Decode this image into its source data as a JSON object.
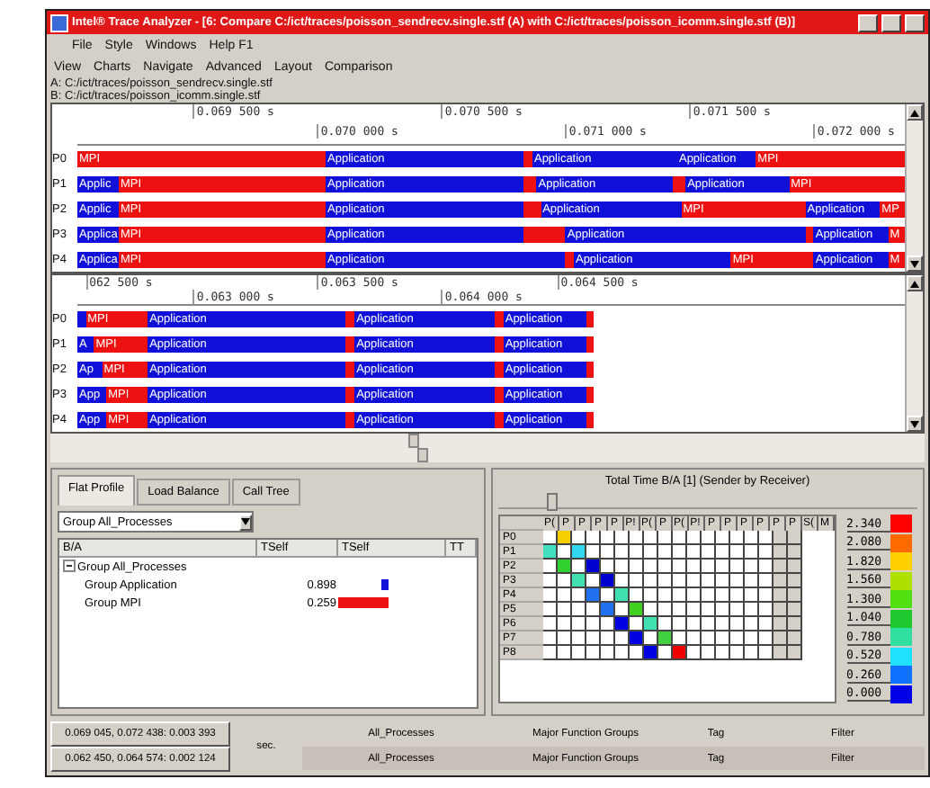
{
  "window": {
    "title": "Intel® Trace Analyzer - [6: Compare C:/ict/traces/poisson_sendrecv.single.stf (A) with C:/ict/traces/poisson_icomm.single.stf (B)]"
  },
  "menu_bar": [
    "File",
    "Style",
    "Windows",
    "Help F1"
  ],
  "view_menu": [
    "View",
    "Charts",
    "Navigate",
    "Advanced",
    "Layout",
    "Comparison"
  ],
  "files": [
    "A: C:/ict/traces/poisson_sendrecv.single.stf",
    "B: C:/ict/traces/poisson_icomm.single.stf"
  ],
  "timeline_a": {
    "ruler_upper": [
      "0.069 500 s",
      "0.070 500 s",
      "0.071 500 s"
    ],
    "ruler_lower": [
      "0.070 000 s",
      "0.071 000 s",
      "0.072 000 s"
    ],
    "rows": [
      {
        "label": "P0",
        "segments": [
          {
            "kind": "mpi",
            "label": "MPI"
          },
          {
            "kind": "app",
            "label": "Application"
          },
          {
            "kind": "mpi"
          },
          {
            "kind": "app",
            "label": "Application"
          },
          {
            "kind": "app",
            "label": "Application"
          },
          {
            "kind": "mpi",
            "label": "MPI"
          }
        ]
      },
      {
        "label": "P1",
        "segments": [
          {
            "kind": "app",
            "label": "Applic"
          },
          {
            "kind": "mpi",
            "label": "MPI"
          },
          {
            "kind": "app",
            "label": "Application"
          },
          {
            "kind": "mpi"
          },
          {
            "kind": "app",
            "label": "Application"
          },
          {
            "kind": "mpi"
          },
          {
            "kind": "app",
            "label": "Application"
          },
          {
            "kind": "mpi",
            "label": "MPI"
          }
        ]
      },
      {
        "label": "P2",
        "segments": [
          {
            "kind": "app",
            "label": "Applic"
          },
          {
            "kind": "mpi",
            "label": "MPI"
          },
          {
            "kind": "app",
            "label": "Application"
          },
          {
            "kind": "mpi"
          },
          {
            "kind": "app",
            "label": "Application"
          },
          {
            "kind": "mpi",
            "label": "MPI"
          },
          {
            "kind": "app",
            "label": "Application"
          },
          {
            "kind": "mpi",
            "label": "MP"
          }
        ]
      },
      {
        "label": "P3",
        "segments": [
          {
            "kind": "app",
            "label": "Applica"
          },
          {
            "kind": "mpi",
            "label": "MPI"
          },
          {
            "kind": "app",
            "label": "Application"
          },
          {
            "kind": "mpi"
          },
          {
            "kind": "mpi"
          },
          {
            "kind": "app",
            "label": "Application"
          },
          {
            "kind": "mpi"
          },
          {
            "kind": "app",
            "label": "Application"
          },
          {
            "kind": "mpi",
            "label": "M"
          }
        ]
      },
      {
        "label": "P4",
        "segments": [
          {
            "kind": "app",
            "label": "Applica"
          },
          {
            "kind": "mpi",
            "label": "MPI"
          },
          {
            "kind": "app",
            "label": "Application"
          },
          {
            "kind": "mpi"
          },
          {
            "kind": "app",
            "label": "Application"
          },
          {
            "kind": "mpi",
            "label": "MPI"
          },
          {
            "kind": "app",
            "label": "Application"
          },
          {
            "kind": "mpi",
            "label": "M"
          }
        ]
      }
    ]
  },
  "timeline_b": {
    "ruler_upper": [
      "062 500 s",
      "0.063 500 s",
      "0.064 500 s"
    ],
    "ruler_lower": [
      "0.063 000 s",
      "0.064 000 s"
    ],
    "rows": [
      {
        "label": "P0",
        "segments": [
          {
            "kind": "app"
          },
          {
            "kind": "mpi",
            "label": "MPI"
          },
          {
            "kind": "app",
            "label": "Application"
          },
          {
            "kind": "mpi"
          },
          {
            "kind": "app",
            "label": "Application"
          },
          {
            "kind": "mpi"
          },
          {
            "kind": "app",
            "label": "Application"
          },
          {
            "kind": "mpi"
          }
        ]
      },
      {
        "label": "P1",
        "segments": [
          {
            "kind": "app",
            "label": "A"
          },
          {
            "kind": "mpi",
            "label": "MPI"
          },
          {
            "kind": "app",
            "label": "Application"
          },
          {
            "kind": "mpi"
          },
          {
            "kind": "app",
            "label": "Application"
          },
          {
            "kind": "mpi"
          },
          {
            "kind": "app",
            "label": "Application"
          },
          {
            "kind": "mpi"
          }
        ]
      },
      {
        "label": "P2",
        "segments": [
          {
            "kind": "app",
            "label": "Ap"
          },
          {
            "kind": "mpi",
            "label": "MPI"
          },
          {
            "kind": "app",
            "label": "Application"
          },
          {
            "kind": "mpi"
          },
          {
            "kind": "app",
            "label": "Application"
          },
          {
            "kind": "mpi"
          },
          {
            "kind": "app",
            "label": "Application"
          },
          {
            "kind": "mpi"
          }
        ]
      },
      {
        "label": "P3",
        "segments": [
          {
            "kind": "app",
            "label": "App"
          },
          {
            "kind": "mpi",
            "label": "MPI"
          },
          {
            "kind": "app",
            "label": "Application"
          },
          {
            "kind": "mpi"
          },
          {
            "kind": "app",
            "label": "Application"
          },
          {
            "kind": "mpi"
          },
          {
            "kind": "app",
            "label": "Application"
          },
          {
            "kind": "mpi"
          }
        ]
      },
      {
        "label": "P4",
        "segments": [
          {
            "kind": "app",
            "label": "App"
          },
          {
            "kind": "mpi",
            "label": "MPI"
          },
          {
            "kind": "app",
            "label": "Application"
          },
          {
            "kind": "mpi"
          },
          {
            "kind": "app",
            "label": "Application"
          },
          {
            "kind": "mpi"
          },
          {
            "kind": "app",
            "label": "Application"
          },
          {
            "kind": "mpi"
          }
        ]
      }
    ]
  },
  "profile": {
    "tabs": [
      {
        "label": "Flat Profile",
        "selected": true
      },
      {
        "label": "Load Balance",
        "selected": false
      },
      {
        "label": "Call Tree",
        "selected": false
      }
    ],
    "group_select": "Group All_Processes",
    "columns": [
      "B/A",
      "TSelf",
      "TSelf",
      "TT"
    ],
    "tree": [
      {
        "label": "Group All_Processes",
        "expanded": true,
        "children": [
          {
            "label": "Group Application",
            "value": "0.898",
            "kind": "app"
          },
          {
            "label": "Group MPI",
            "value": "0.259",
            "kind": "mpi"
          }
        ]
      }
    ]
  },
  "matrix": {
    "title": "Total Time B/A [1] (Sender by Receiver)",
    "slider": {
      "level": 0.13
    },
    "columns": [
      "P(",
      "P",
      "P",
      "P",
      "P",
      "P!",
      "P(",
      "P",
      "P(",
      "P!",
      "P",
      "P",
      "P",
      "P",
      "P",
      "P",
      "S(",
      "M"
    ],
    "rows": [
      {
        "label": "P0",
        "cells": [
          {
            "color": "#ffffff"
          },
          {
            "color": "#f5d000"
          },
          {
            "color": "#ffffff"
          },
          {
            "color": "#ffffff"
          },
          {
            "color": "#ffffff"
          },
          {
            "color": "#ffffff"
          },
          {
            "color": "#ffffff"
          },
          {
            "color": "#ffffff"
          },
          {
            "color": "#ffffff"
          },
          {
            "color": "#ffffff"
          },
          {
            "color": "#ffffff"
          },
          {
            "color": "#ffffff"
          },
          {
            "color": "#ffffff"
          },
          {
            "color": "#ffffff"
          },
          {
            "color": "#ffffff"
          },
          {
            "color": "#ffffff"
          }
        ]
      },
      {
        "label": "P1",
        "cells": [
          {
            "color": "#40e0c0"
          },
          {
            "color": "#ffffff"
          },
          {
            "color": "#30d8f0"
          },
          {
            "color": "#ffffff"
          },
          {
            "color": "#ffffff"
          },
          {
            "color": "#ffffff"
          },
          {
            "color": "#ffffff"
          },
          {
            "color": "#ffffff"
          },
          {
            "color": "#ffffff"
          },
          {
            "color": "#ffffff"
          },
          {
            "color": "#ffffff"
          },
          {
            "color": "#ffffff"
          },
          {
            "color": "#ffffff"
          },
          {
            "color": "#ffffff"
          },
          {
            "color": "#ffffff"
          },
          {
            "color": "#ffffff"
          }
        ]
      },
      {
        "label": "P2",
        "cells": [
          {
            "color": "#ffffff"
          },
          {
            "color": "#30d030"
          },
          {
            "color": "#ffffff"
          },
          {
            "color": "#0000d0"
          },
          {
            "color": "#ffffff"
          },
          {
            "color": "#ffffff"
          },
          {
            "color": "#ffffff"
          },
          {
            "color": "#ffffff"
          },
          {
            "color": "#ffffff"
          },
          {
            "color": "#ffffff"
          },
          {
            "color": "#ffffff"
          },
          {
            "color": "#ffffff"
          },
          {
            "color": "#ffffff"
          },
          {
            "color": "#ffffff"
          },
          {
            "color": "#ffffff"
          },
          {
            "color": "#ffffff"
          }
        ]
      },
      {
        "label": "P3",
        "cells": [
          {
            "color": "#ffffff"
          },
          {
            "color": "#ffffff"
          },
          {
            "color": "#40e0b0"
          },
          {
            "color": "#ffffff"
          },
          {
            "color": "#0000d0"
          },
          {
            "color": "#ffffff"
          },
          {
            "color": "#ffffff"
          },
          {
            "color": "#ffffff"
          },
          {
            "color": "#ffffff"
          },
          {
            "color": "#ffffff"
          },
          {
            "color": "#ffffff"
          },
          {
            "color": "#ffffff"
          },
          {
            "color": "#ffffff"
          },
          {
            "color": "#ffffff"
          },
          {
            "color": "#ffffff"
          },
          {
            "color": "#ffffff"
          }
        ]
      },
      {
        "label": "P4",
        "cells": [
          {
            "color": "#ffffff"
          },
          {
            "color": "#ffffff"
          },
          {
            "color": "#ffffff"
          },
          {
            "color": "#2070f0"
          },
          {
            "color": "#ffffff"
          },
          {
            "color": "#40e0b0"
          },
          {
            "color": "#ffffff"
          },
          {
            "color": "#ffffff"
          },
          {
            "color": "#ffffff"
          },
          {
            "color": "#ffffff"
          },
          {
            "color": "#ffffff"
          },
          {
            "color": "#ffffff"
          },
          {
            "color": "#ffffff"
          },
          {
            "color": "#ffffff"
          },
          {
            "color": "#ffffff"
          },
          {
            "color": "#ffffff"
          }
        ]
      },
      {
        "label": "P5",
        "cells": [
          {
            "color": "#ffffff"
          },
          {
            "color": "#ffffff"
          },
          {
            "color": "#ffffff"
          },
          {
            "color": "#ffffff"
          },
          {
            "color": "#2070f0"
          },
          {
            "color": "#ffffff"
          },
          {
            "color": "#40d020"
          },
          {
            "color": "#ffffff"
          },
          {
            "color": "#ffffff"
          },
          {
            "color": "#ffffff"
          },
          {
            "color": "#ffffff"
          },
          {
            "color": "#ffffff"
          },
          {
            "color": "#ffffff"
          },
          {
            "color": "#ffffff"
          },
          {
            "color": "#ffffff"
          },
          {
            "color": "#ffffff"
          }
        ]
      },
      {
        "label": "P6",
        "cells": [
          {
            "color": "#ffffff"
          },
          {
            "color": "#ffffff"
          },
          {
            "color": "#ffffff"
          },
          {
            "color": "#ffffff"
          },
          {
            "color": "#ffffff"
          },
          {
            "color": "#0000e0"
          },
          {
            "color": "#ffffff"
          },
          {
            "color": "#40e0b0"
          },
          {
            "color": "#ffffff"
          },
          {
            "color": "#ffffff"
          },
          {
            "color": "#ffffff"
          },
          {
            "color": "#ffffff"
          },
          {
            "color": "#ffffff"
          },
          {
            "color": "#ffffff"
          },
          {
            "color": "#ffffff"
          },
          {
            "color": "#ffffff"
          }
        ]
      },
      {
        "label": "P7",
        "cells": [
          {
            "color": "#ffffff"
          },
          {
            "color": "#ffffff"
          },
          {
            "color": "#ffffff"
          },
          {
            "color": "#ffffff"
          },
          {
            "color": "#ffffff"
          },
          {
            "color": "#ffffff"
          },
          {
            "color": "#0000e0"
          },
          {
            "color": "#ffffff"
          },
          {
            "color": "#40d040"
          },
          {
            "color": "#ffffff"
          },
          {
            "color": "#ffffff"
          },
          {
            "color": "#ffffff"
          },
          {
            "color": "#ffffff"
          },
          {
            "color": "#ffffff"
          },
          {
            "color": "#ffffff"
          },
          {
            "color": "#ffffff"
          }
        ]
      },
      {
        "label": "P8",
        "cells": [
          {
            "color": "#ffffff"
          },
          {
            "color": "#ffffff"
          },
          {
            "color": "#ffffff"
          },
          {
            "color": "#ffffff"
          },
          {
            "color": "#ffffff"
          },
          {
            "color": "#ffffff"
          },
          {
            "color": "#ffffff"
          },
          {
            "color": "#0000e0"
          },
          {
            "color": "#ffffff"
          },
          {
            "color": "#ee0000"
          },
          {
            "color": "#ffffff"
          },
          {
            "color": "#ffffff"
          },
          {
            "color": "#ffffff"
          },
          {
            "color": "#ffffff"
          },
          {
            "color": "#ffffff"
          },
          {
            "color": "#ffffff"
          }
        ]
      }
    ],
    "legend": [
      {
        "label": "2.340",
        "color": "#ff0000"
      },
      {
        "label": "2.080",
        "color": "#ff6a00"
      },
      {
        "label": "1.820",
        "color": "#ffd000"
      },
      {
        "label": "1.560",
        "color": "#b0e000"
      },
      {
        "label": "1.300",
        "color": "#50e010"
      },
      {
        "label": "1.040",
        "color": "#20c830"
      },
      {
        "label": "0.780",
        "color": "#30e0a0"
      },
      {
        "label": "0.520",
        "color": "#20e0ff"
      },
      {
        "label": "0.260",
        "color": "#1070ff"
      },
      {
        "label": "0.000",
        "color": "#0000e8"
      }
    ]
  },
  "status_bar": {
    "unit": "sec.",
    "rows": [
      {
        "range": "0.069 045, 0.072 438: 0.003 393",
        "processes": "All_Processes",
        "functions": "Major Function Groups",
        "tag": "Tag",
        "filter": "Filter"
      },
      {
        "range": "0.062 450, 0.064 574: 0.002 124",
        "processes": "All_Processes",
        "functions": "Major Function Groups",
        "tag": "Tag",
        "filter": "Filter"
      }
    ]
  }
}
